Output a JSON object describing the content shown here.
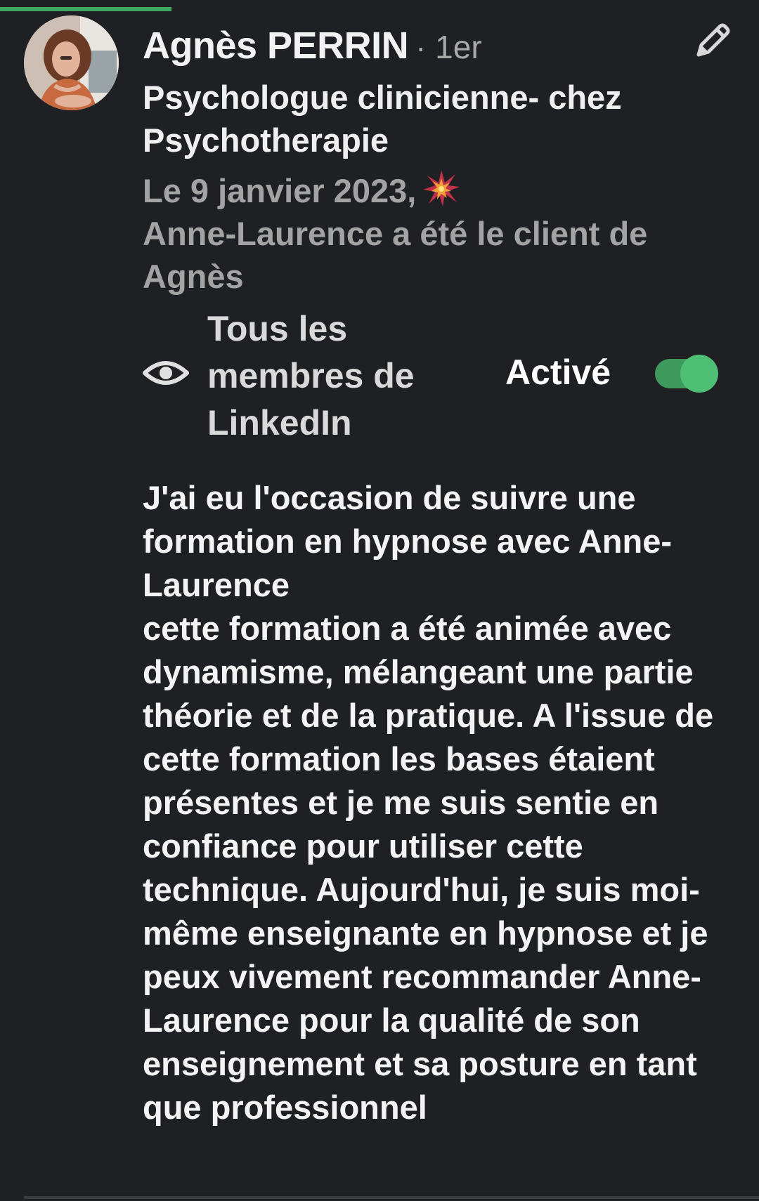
{
  "profile": {
    "name": "Agnès PERRIN",
    "degree": "· 1er",
    "headline": "Psychologue clinicienne- chez Psychotherapie",
    "avatar": "avatar-photo"
  },
  "meta": {
    "date": "Le 9 janvier 2023,",
    "relation": "Anne-Laurence a été le client de Agnès",
    "emoji": "burst-icon"
  },
  "visibility": {
    "icon": "eye-icon",
    "label": "Tous les membres de LinkedIn",
    "status": "Activé",
    "enabled": true,
    "accent_color": "#3fa65e"
  },
  "recommendation": {
    "text": "J'ai eu l'occasion de suivre une formation en hypnose avec Anne-Laurence\ncette formation a été animée avec dynamisme, mélangeant une partie théorie et de la pratique. A l'issue de cette formation les bases étaient présentes et je me suis sentie en confiance pour utiliser cette technique. Aujourd'hui, je suis moi-même enseignante en hypnose et je peux vivement recommander Anne-Laurence pour la qualité de son enseignement et sa posture en tant que professionnel"
  },
  "actions": {
    "edit_icon": "pencil-icon"
  }
}
